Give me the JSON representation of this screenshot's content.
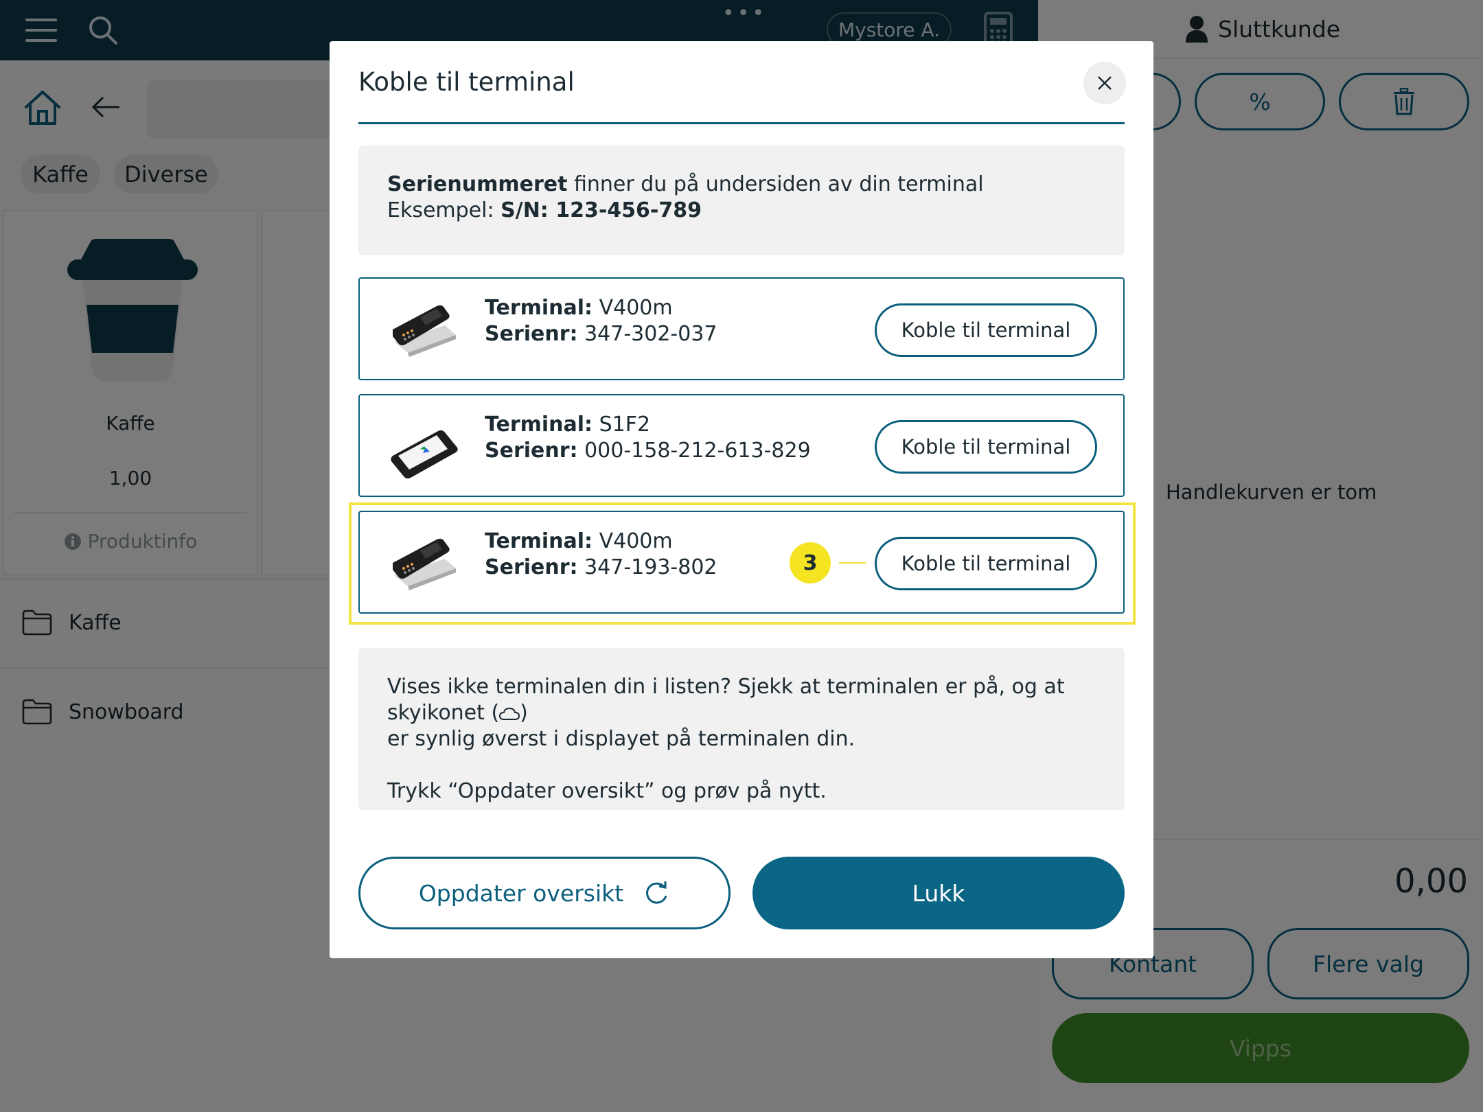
{
  "topbar": {
    "menu_icon": "hamburger-icon",
    "search_icon": "search-icon",
    "more_icon": "more-dots-icon",
    "store_name": "Mystore A.",
    "calculator_icon": "calculator-icon"
  },
  "nav": {
    "home_icon": "home-icon",
    "back_icon": "arrow-left-icon"
  },
  "chips": [
    "Kaffe",
    "Diverse"
  ],
  "product": {
    "name": "Kaffe",
    "price": "1,00",
    "info_label": "Produktinfo"
  },
  "folders": [
    "Kaffe",
    "Snowboard"
  ],
  "cart": {
    "customer_label": "Sluttkunde",
    "empty_text": "Handlekurven er tom",
    "total": "0,00",
    "percent_symbol": "%",
    "cash_label": "Kontant",
    "more_label": "Flere valg",
    "vipps_label": "Vipps"
  },
  "modal": {
    "title": "Koble til terminal",
    "info_serial_bold": "Serienummeret",
    "info_serial_rest": " finner du på undersiden av din terminal",
    "info_example_label": "Eksempel: ",
    "info_example_value": "S/N: 123-456-789",
    "terminal_label": "Terminal:",
    "serial_label": "Serienr:",
    "terminals": [
      {
        "model": "V400m",
        "serial": "347-302-037",
        "button": "Koble til terminal"
      },
      {
        "model": "S1F2",
        "serial": "000-158-212-613-829",
        "button": "Koble til terminal"
      },
      {
        "model": "V400m",
        "serial": "347-193-802",
        "button": "Koble til terminal"
      }
    ],
    "step_number": "3",
    "help_line1_a": "Vises ikke terminalen din i listen? Sjekk at terminalen er på, og at skyikonet (",
    "help_line1_b": ")",
    "help_line2": "er synlig øverst i displayet på terminalen din.",
    "help_line3": "Trykk “Oppdater oversikt” og prøv på nytt.",
    "refresh_label": "Oppdater oversikt",
    "close_label": "Lukk"
  },
  "colors": {
    "brand": "#0b5f7d",
    "topbar": "#0f3b4d",
    "highlight": "#f5e33f",
    "vipps": "#3e8a2a"
  }
}
